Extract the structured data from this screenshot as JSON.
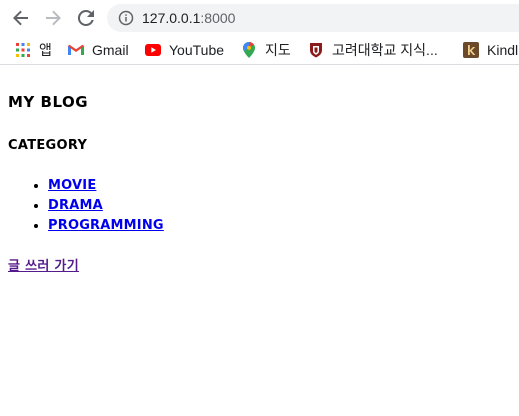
{
  "browser": {
    "url": {
      "host": "127.0.0.1",
      "port": ":8000"
    },
    "bookmarks": [
      {
        "label": "앱",
        "icon": "apps-grid-icon"
      },
      {
        "label": "Gmail",
        "icon": "gmail-icon"
      },
      {
        "label": "YouTube",
        "icon": "youtube-icon"
      },
      {
        "label": "지도",
        "icon": "maps-pin-icon"
      },
      {
        "label": "고려대학교 지식...",
        "icon": "korea-university-icon"
      },
      {
        "label": "Kindl",
        "icon": "kindle-icon"
      }
    ]
  },
  "page": {
    "title": "MY BLOG",
    "category_heading": "CATEGORY",
    "categories": [
      "MOVIE",
      "DRAMA",
      "PROGRAMMING"
    ],
    "write_link": "글 쓰러 가기"
  },
  "colors": {
    "link": "#0000ee",
    "visited_link": "#551a8b"
  }
}
